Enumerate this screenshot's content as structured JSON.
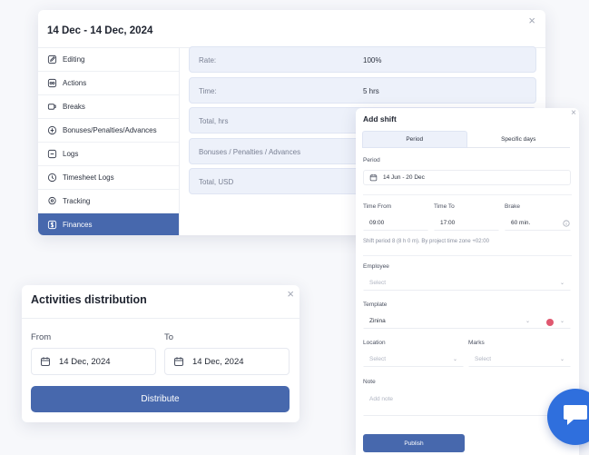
{
  "finance_panel": {
    "title": "14 Dec -  14 Dec, 2024",
    "close_icon": "×",
    "sidebar": [
      {
        "label": "Editing",
        "icon": "edit-icon",
        "active": false
      },
      {
        "label": "Actions",
        "icon": "actions-icon",
        "active": false
      },
      {
        "label": "Breaks",
        "icon": "coffee-icon",
        "active": false
      },
      {
        "label": "Bonuses/Penalties/Advances",
        "icon": "bonus-icon",
        "active": false
      },
      {
        "label": "Logs",
        "icon": "logs-icon",
        "active": false
      },
      {
        "label": "Timesheet Logs",
        "icon": "clock-icon",
        "active": false
      },
      {
        "label": "Tracking",
        "icon": "location-icon",
        "active": false
      },
      {
        "label": "Finances",
        "icon": "dollar-icon",
        "active": true
      }
    ],
    "rows": [
      {
        "label": "Rate:",
        "value": "100%"
      },
      {
        "label": "Time:",
        "value": "5 hrs"
      },
      {
        "label": "Total, hrs",
        "value": ""
      },
      {
        "label": "Bonuses / Penalties / Advances",
        "value": ""
      },
      {
        "label": "Total, USD",
        "value": ""
      }
    ]
  },
  "activities": {
    "title": "Activities distribution",
    "close_icon": "×",
    "from_label": "From",
    "to_label": "To",
    "from_value": "14 Dec, 2024",
    "to_value": "14 Dec, 2024",
    "distribute_label": "Distribute"
  },
  "add_shift": {
    "title": "Add shift",
    "close_icon": "×",
    "tabs": [
      "Period",
      "Specific days"
    ],
    "active_tab": "Period",
    "period_label": "Period",
    "period_value": "14 Jun  -  20 Dec",
    "time_from_label": "Time From",
    "time_to_label": "Time To",
    "break_label": "Brake",
    "time_from_value": "09:00",
    "time_to_value": "17:00",
    "break_value": "60 min.",
    "shift_hint": "Shift period 8 (8 h 0 m). By project time zone +02:00",
    "employee_label": "Employee",
    "employee_placeholder": "Select",
    "template_label": "Template",
    "template_value": "Zinina",
    "template_color": "#e05870",
    "location_label": "Location",
    "location_placeholder": "Select",
    "marks_label": "Marks",
    "marks_placeholder": "Select",
    "note_label": "Note",
    "note_placeholder": "Add note",
    "publish_label": "Publish"
  },
  "colors": {
    "accent": "#4768ad",
    "row_background": "#edf1fa",
    "chat_bubble": "#2f6fdd"
  }
}
